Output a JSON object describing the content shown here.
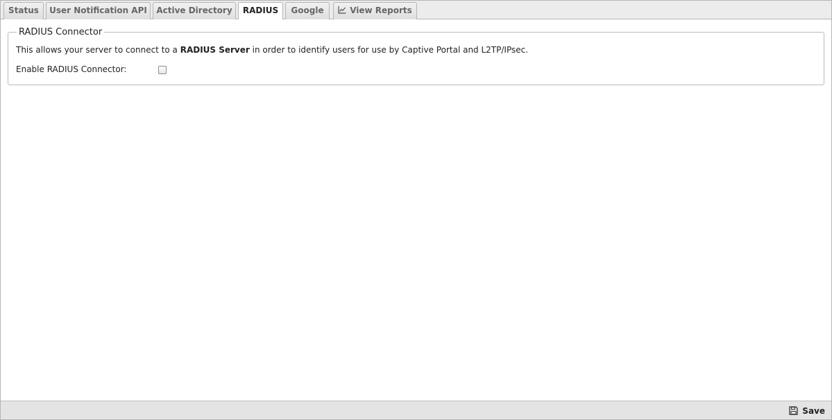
{
  "tabs": [
    {
      "label": "Status"
    },
    {
      "label": "User Notification API"
    },
    {
      "label": "Active Directory"
    },
    {
      "label": "RADIUS"
    },
    {
      "label": "Google"
    },
    {
      "label": "View Reports",
      "icon": "chart-line-icon"
    }
  ],
  "active_tab": "RADIUS",
  "radius": {
    "legend": "RADIUS Connector",
    "desc_before": "This allows your server to connect to a ",
    "desc_bold": "RADIUS Server",
    "desc_after": " in order to identify users for use by Captive Portal and L2TP/IPsec.",
    "enable_label": "Enable RADIUS Connector:",
    "enabled": false
  },
  "footer": {
    "save_label": "Save",
    "save_icon": "floppy-disk-icon"
  },
  "colors": {
    "tab_bar_bg": "#ececec",
    "border": "#b5b5b5",
    "footer_bg": "#e4e4e4"
  }
}
